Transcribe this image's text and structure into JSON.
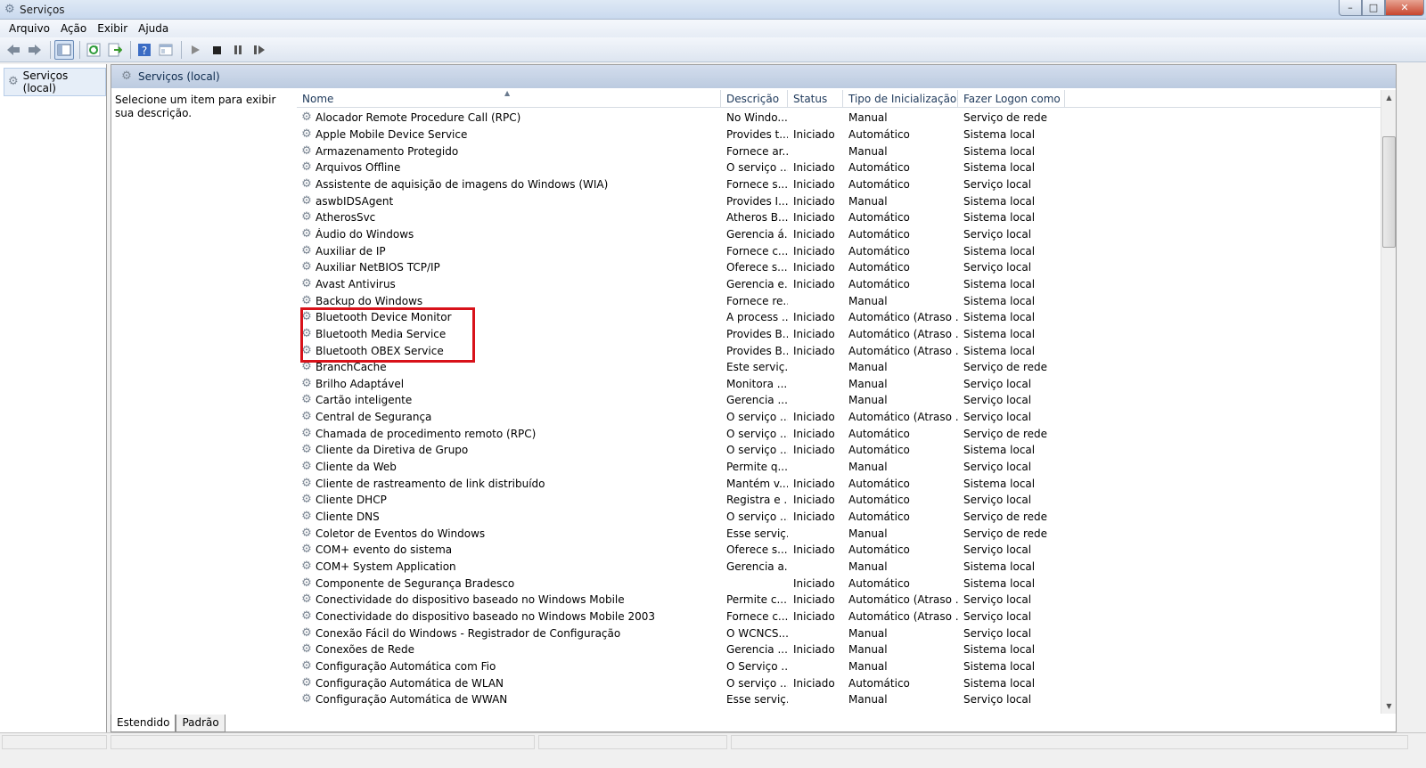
{
  "window": {
    "title": "Serviços",
    "min": "–",
    "max": "□",
    "close": "✕"
  },
  "menu": [
    "Arquivo",
    "Ação",
    "Exibir",
    "Ajuda"
  ],
  "tree": {
    "item": "Serviços (local)"
  },
  "pane": {
    "header": "Serviços (local)",
    "description": "Selecione um item para exibir sua descrição."
  },
  "columns": {
    "name": "Nome",
    "desc": "Descrição",
    "status": "Status",
    "type": "Tipo de Inicialização",
    "logon": "Fazer Logon como"
  },
  "services": [
    [
      "Alocador Remote Procedure Call (RPC)",
      "No Windo...",
      "",
      "Manual",
      "Serviço de rede"
    ],
    [
      "Apple Mobile Device Service",
      "Provides t...",
      "Iniciado",
      "Automático",
      "Sistema local"
    ],
    [
      "Armazenamento Protegido",
      "Fornece ar...",
      "",
      "Manual",
      "Sistema local"
    ],
    [
      "Arquivos Offline",
      "O serviço ...",
      "Iniciado",
      "Automático",
      "Sistema local"
    ],
    [
      "Assistente de aquisição de imagens do Windows (WIA)",
      "Fornece s...",
      "Iniciado",
      "Automático",
      "Serviço local"
    ],
    [
      "aswbIDSAgent",
      "Provides I...",
      "Iniciado",
      "Manual",
      "Sistema local"
    ],
    [
      "AtherosSvc",
      "Atheros B...",
      "Iniciado",
      "Automático",
      "Sistema local"
    ],
    [
      "Áudio do Windows",
      "Gerencia á...",
      "Iniciado",
      "Automático",
      "Serviço local"
    ],
    [
      "Auxiliar de IP",
      "Fornece c...",
      "Iniciado",
      "Automático",
      "Sistema local"
    ],
    [
      "Auxiliar NetBIOS TCP/IP",
      "Oferece s...",
      "Iniciado",
      "Automático",
      "Serviço local"
    ],
    [
      "Avast Antivirus",
      "Gerencia e...",
      "Iniciado",
      "Automático",
      "Sistema local"
    ],
    [
      "Backup do Windows",
      "Fornece re...",
      "",
      "Manual",
      "Sistema local"
    ],
    [
      "Bluetooth Device Monitor",
      "A process ...",
      "Iniciado",
      "Automático (Atraso ...",
      "Sistema local"
    ],
    [
      "Bluetooth Media Service",
      "Provides B...",
      "Iniciado",
      "Automático (Atraso ...",
      "Sistema local"
    ],
    [
      "Bluetooth OBEX Service",
      "Provides B...",
      "Iniciado",
      "Automático (Atraso ...",
      "Sistema local"
    ],
    [
      "BranchCache",
      "Este serviç...",
      "",
      "Manual",
      "Serviço de rede"
    ],
    [
      "Brilho Adaptável",
      "Monitora ...",
      "",
      "Manual",
      "Serviço local"
    ],
    [
      "Cartão inteligente",
      "Gerencia ...",
      "",
      "Manual",
      "Serviço local"
    ],
    [
      "Central de Segurança",
      "O serviço ...",
      "Iniciado",
      "Automático (Atraso ...",
      "Serviço local"
    ],
    [
      "Chamada de procedimento remoto (RPC)",
      "O serviço ...",
      "Iniciado",
      "Automático",
      "Serviço de rede"
    ],
    [
      "Cliente da Diretiva de Grupo",
      "O serviço ...",
      "Iniciado",
      "Automático",
      "Sistema local"
    ],
    [
      "Cliente da Web",
      "Permite q...",
      "",
      "Manual",
      "Serviço local"
    ],
    [
      "Cliente de rastreamento de link distribuído",
      "Mantém v...",
      "Iniciado",
      "Automático",
      "Sistema local"
    ],
    [
      "Cliente DHCP",
      "Registra e ...",
      "Iniciado",
      "Automático",
      "Serviço local"
    ],
    [
      "Cliente DNS",
      "O serviço ...",
      "Iniciado",
      "Automático",
      "Serviço de rede"
    ],
    [
      "Coletor de Eventos do Windows",
      "Esse serviç...",
      "",
      "Manual",
      "Serviço de rede"
    ],
    [
      "COM+ evento do sistema",
      "Oferece s...",
      "Iniciado",
      "Automático",
      "Serviço local"
    ],
    [
      "COM+ System Application",
      "Gerencia a...",
      "",
      "Manual",
      "Sistema local"
    ],
    [
      "Componente de Segurança Bradesco",
      "",
      "Iniciado",
      "Automático",
      "Sistema local"
    ],
    [
      "Conectividade do dispositivo baseado no Windows Mobile",
      "Permite c...",
      "Iniciado",
      "Automático (Atraso ...",
      "Serviço local"
    ],
    [
      "Conectividade do dispositivo baseado no Windows Mobile 2003",
      "Fornece c...",
      "Iniciado",
      "Automático (Atraso ...",
      "Serviço local"
    ],
    [
      "Conexão Fácil do Windows - Registrador de Configuração",
      "O WCNCS...",
      "",
      "Manual",
      "Serviço local"
    ],
    [
      "Conexões de Rede",
      "Gerencia ...",
      "Iniciado",
      "Manual",
      "Sistema local"
    ],
    [
      "Configuração Automática com Fio",
      "O Serviço ...",
      "",
      "Manual",
      "Sistema local"
    ],
    [
      "Configuração Automática de WLAN",
      "O serviço ...",
      "Iniciado",
      "Automático",
      "Sistema local"
    ],
    [
      "Configuração Automática de WWAN",
      "Esse serviç...",
      "",
      "Manual",
      "Serviço local"
    ]
  ],
  "tabs": [
    "Estendido",
    "Padrão"
  ]
}
